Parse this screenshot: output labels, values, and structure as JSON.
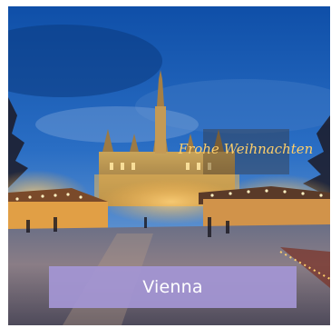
{
  "card": {
    "city_name": "Vienna",
    "photo_sign_text": "Frohe Weihnachten",
    "caption_color": "#a496d4"
  }
}
